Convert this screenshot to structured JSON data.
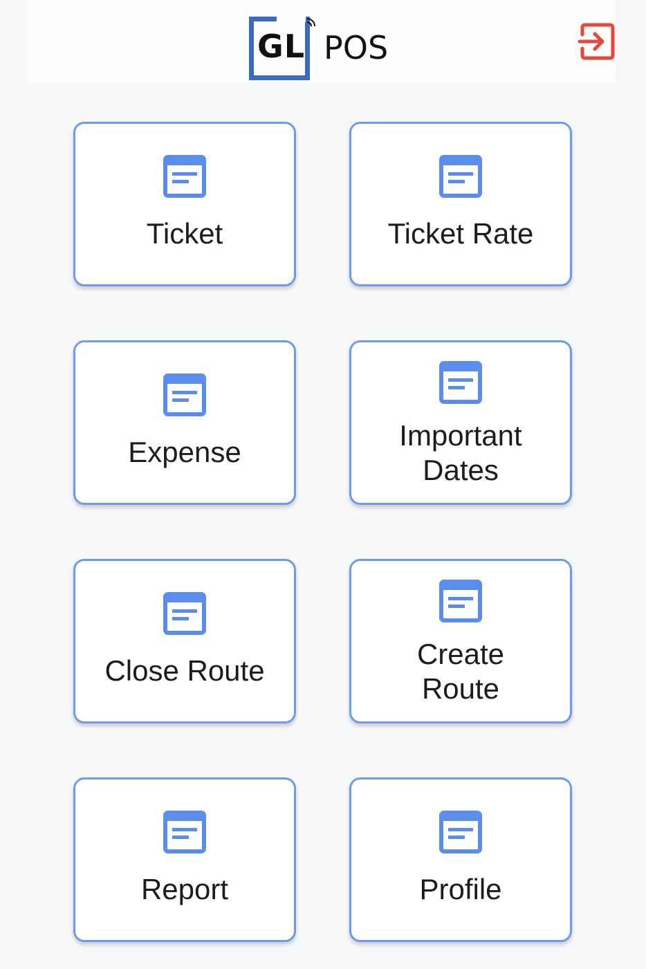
{
  "header": {
    "logo_gl": "GL",
    "logo_pos": "POS",
    "logout_icon": "logout-icon",
    "logout_color": "#e8453c"
  },
  "accent": "#6b9bf0",
  "icon_color": "#5b8def",
  "menu": [
    {
      "label": "Ticket",
      "icon": "document-icon"
    },
    {
      "label": "Ticket Rate",
      "icon": "document-icon"
    },
    {
      "label": "Expense",
      "icon": "document-icon"
    },
    {
      "label": "Important Dates",
      "icon": "document-icon"
    },
    {
      "label": "Close Route",
      "icon": "document-icon"
    },
    {
      "label": "Create Route",
      "icon": "document-icon"
    },
    {
      "label": "Report",
      "icon": "document-icon"
    },
    {
      "label": "Profile",
      "icon": "document-icon"
    }
  ]
}
